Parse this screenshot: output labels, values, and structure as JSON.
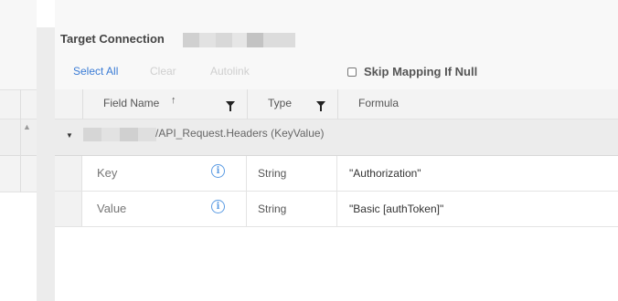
{
  "header": {
    "title": "Target Connection"
  },
  "toolbar": {
    "select_all": "Select All",
    "clear": "Clear",
    "autolink": "Autolink",
    "skip_mapping": "Skip Mapping If Null"
  },
  "table": {
    "columns": {
      "field_name": "Field Name",
      "sort_glyph": "↑",
      "type": "Type",
      "formula": "Formula"
    },
    "group": {
      "label": "/API_Request.Headers (KeyValue)",
      "caret": "▼"
    },
    "rows": [
      {
        "field": "Key",
        "info": "i",
        "type": "String",
        "formula": "\"Authorization\""
      },
      {
        "field": "Value",
        "info": "i",
        "type": "String",
        "formula": "\"Basic [authToken]\""
      }
    ]
  },
  "scroll": {
    "up_glyph": "▲"
  },
  "colors": {
    "accent": "#3a7bd5",
    "disabled": "#cfcfcf",
    "info": "#5b9be3"
  }
}
